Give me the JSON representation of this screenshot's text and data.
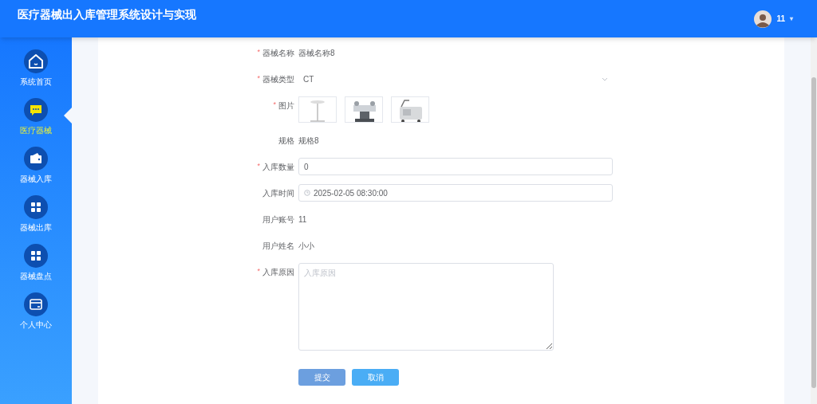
{
  "header": {
    "title": "医疗器械出入库管理系统设计与实现",
    "user": {
      "name": "11",
      "caret": "▾"
    }
  },
  "sidebar": {
    "items": [
      {
        "label": "系统首页",
        "selected": false
      },
      {
        "label": "医疗器械",
        "selected": true
      },
      {
        "label": "器械入库",
        "selected": false
      },
      {
        "label": "器械出库",
        "selected": false
      },
      {
        "label": "器械盘点",
        "selected": false
      },
      {
        "label": "个人中心",
        "selected": false
      }
    ]
  },
  "form": {
    "fields": [
      {
        "label": "器械名称",
        "marker": "*",
        "kind": "text",
        "value": "器械名称8"
      },
      {
        "label": "器械类型",
        "marker": "*",
        "kind": "select",
        "value": "CT"
      },
      {
        "label": "图片",
        "marker": "*",
        "kind": "images"
      },
      {
        "label": "规格",
        "kind": "text",
        "value": "规格8"
      },
      {
        "label": "入库数量",
        "marker": "*",
        "kind": "input",
        "value": "0"
      },
      {
        "label": "入库时间",
        "kind": "datetime",
        "value": "2025-02-05 08:30:00"
      },
      {
        "label": "用户账号",
        "kind": "text",
        "value": "11"
      },
      {
        "label": "用户姓名",
        "kind": "text",
        "value": "小小"
      },
      {
        "label": "入库原因",
        "marker": "*",
        "kind": "textarea",
        "placeholder": "入库原因"
      }
    ],
    "buttons": [
      {
        "label": "提交",
        "kind": "submit"
      },
      {
        "label": "取消",
        "kind": "cancel"
      }
    ]
  }
}
